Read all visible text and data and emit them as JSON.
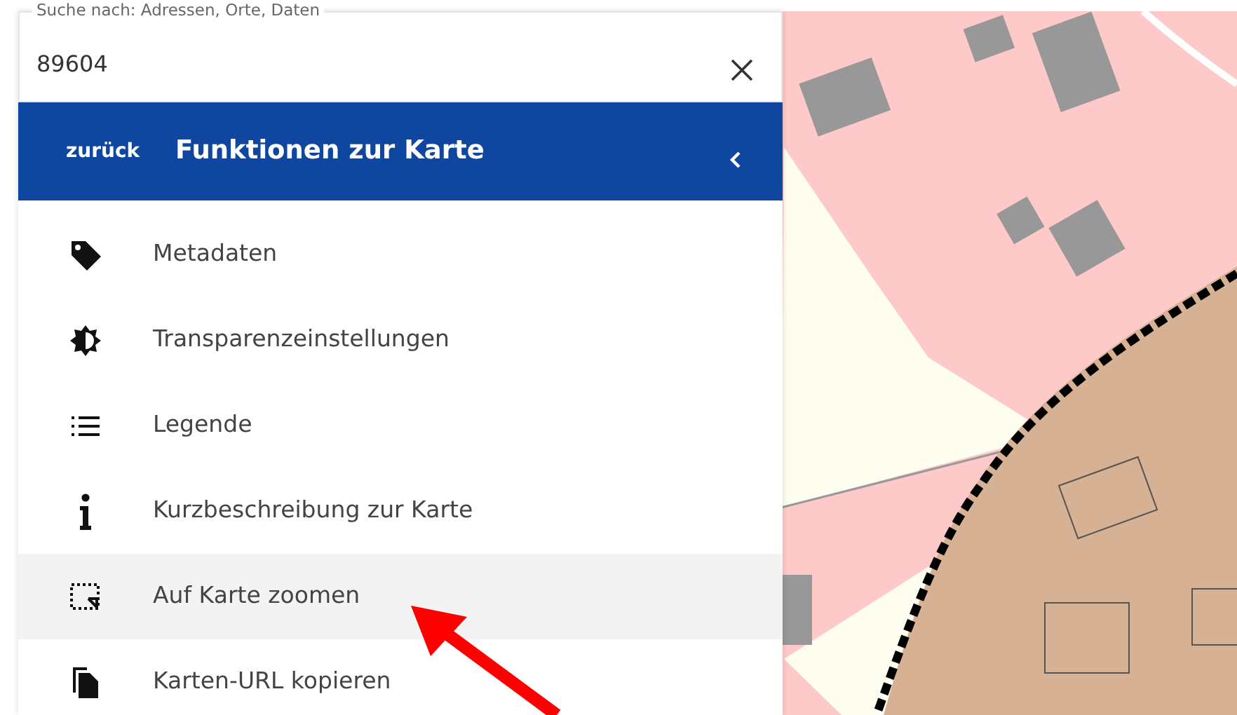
{
  "search": {
    "label": "Suche nach: Adressen, Orte, Daten",
    "value": "89604"
  },
  "header": {
    "back": "zurück",
    "title": "Funktionen zur Karte"
  },
  "items": [
    {
      "label": "Metadaten",
      "selected": false
    },
    {
      "label": "Transparenzeinstellungen",
      "selected": false
    },
    {
      "label": "Legende",
      "selected": false
    },
    {
      "label": "Kurzbeschreibung zur Karte",
      "selected": false
    },
    {
      "label": "Auf Karte zoomen",
      "selected": true
    },
    {
      "label": "Karten-URL kopieren",
      "selected": false
    }
  ]
}
